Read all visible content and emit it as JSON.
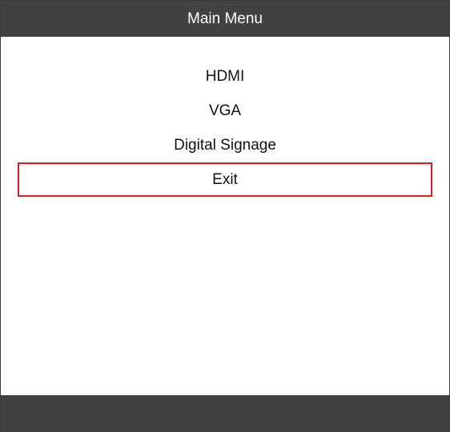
{
  "header": {
    "title": "Main Menu"
  },
  "menu": {
    "items": [
      {
        "label": "HDMI"
      },
      {
        "label": "VGA"
      },
      {
        "label": "Digital Signage"
      },
      {
        "label": "Exit"
      }
    ],
    "selected_index": 3
  },
  "colors": {
    "bar_background": "#424242",
    "selection_border": "#e21b1b",
    "text": "#111111",
    "header_text": "#ffffff"
  }
}
